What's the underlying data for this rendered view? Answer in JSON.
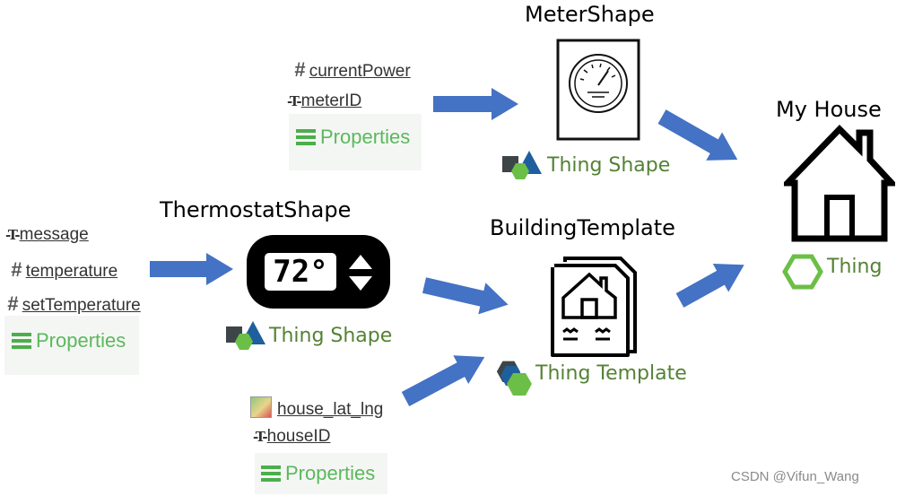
{
  "meter": {
    "title": "MeterShape",
    "properties": [
      "currentPower",
      "meterID"
    ],
    "properties_label": "Properties",
    "type_label": "Thing Shape"
  },
  "house": {
    "title": "My House",
    "type_label": "Thing"
  },
  "thermostat": {
    "title": "ThermostatShape",
    "display": "72°",
    "properties": [
      "message",
      "temperature",
      "setTemperature"
    ],
    "properties_label": "Properties",
    "type_label": "Thing Shape"
  },
  "building": {
    "title": "BuildingTemplate",
    "properties": [
      "house_lat_lng",
      "houseID"
    ],
    "properties_label": "Properties",
    "type_label": "Thing Template"
  },
  "watermark": "CSDN @Vifun_Wang",
  "colors": {
    "arrow": "#4472c4",
    "green_text": "#548235",
    "properties_green": "#5cb85c",
    "hexagon": "#6cbf46"
  }
}
